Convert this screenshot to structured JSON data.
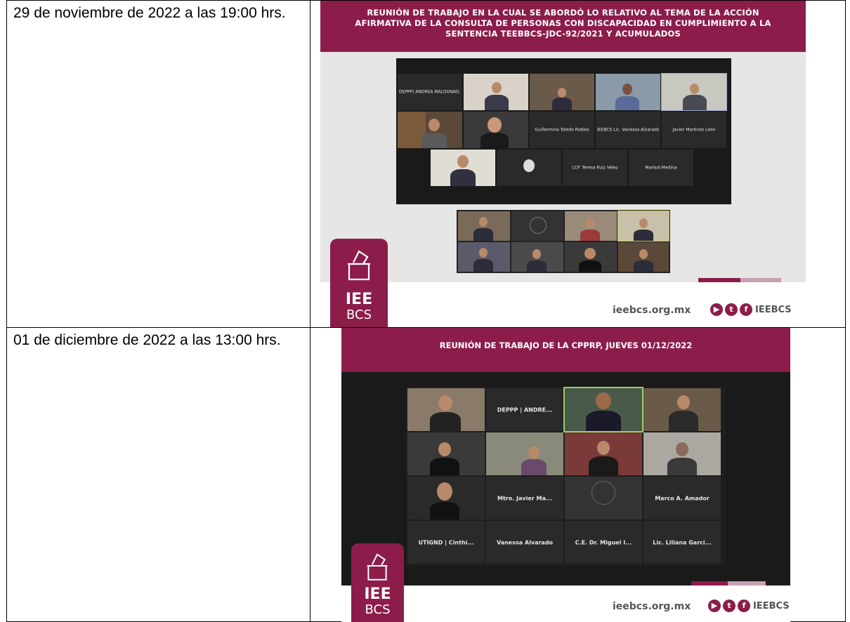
{
  "rows": [
    {
      "date_text": "29 de noviembre de 2022 a las 19:00 hrs.",
      "slide": {
        "banner_title": "REUNIÓN DE TRABAJO EN LA CUAL SE ABORDÓ LO RELATIVO AL TEMA DE LA ACCIÓN AFIRMATIVA DE LA CONSULTA DE PERSONAS CON DISCAPACIDAD EN CUMPLIMIENTO A LA SENTENCIA TEEBBCS-JDC-92/2021 Y ACUMULADOS",
        "tiles": [
          "DEPPP| ANDREA MALDONAD...",
          "Guillermina Toledo Robles",
          "IEEBCS Lic. Vanessa Alvarado",
          "Javier Martinez León",
          "LCP. Teresa Ruiz Vélez",
          "Marisol Medina"
        ],
        "footer_url": "ieebcs.org.mx",
        "social_handle": "IEEBCS"
      }
    },
    {
      "date_text": "01 de diciembre de 2022 a las 13:00 hrs.",
      "slide": {
        "banner_title": "REUNIÓN DE TRABAJO DE LA CPPRP, JUEVES 01/12/2022",
        "tiles": [
          "DEPPP | ANDRE...",
          "Mtro. Javier Ma...",
          "Marco A. Amador",
          "UTIGND | Cinthi...",
          "Vanessa Alvarado",
          "C.E. Dr. Miguel I...",
          "Lic. Liliana Garci..."
        ],
        "footer_url": "ieebcs.org.mx",
        "social_handle": "IEEBCS"
      }
    }
  ],
  "logo": {
    "line1": "IEE",
    "line2": "BCS"
  },
  "colors": {
    "brand": "#8c1d4b",
    "brand_light": "#c8a0b4"
  },
  "icons": [
    "ballot-box-icon",
    "youtube-icon",
    "twitter-icon",
    "facebook-icon"
  ]
}
